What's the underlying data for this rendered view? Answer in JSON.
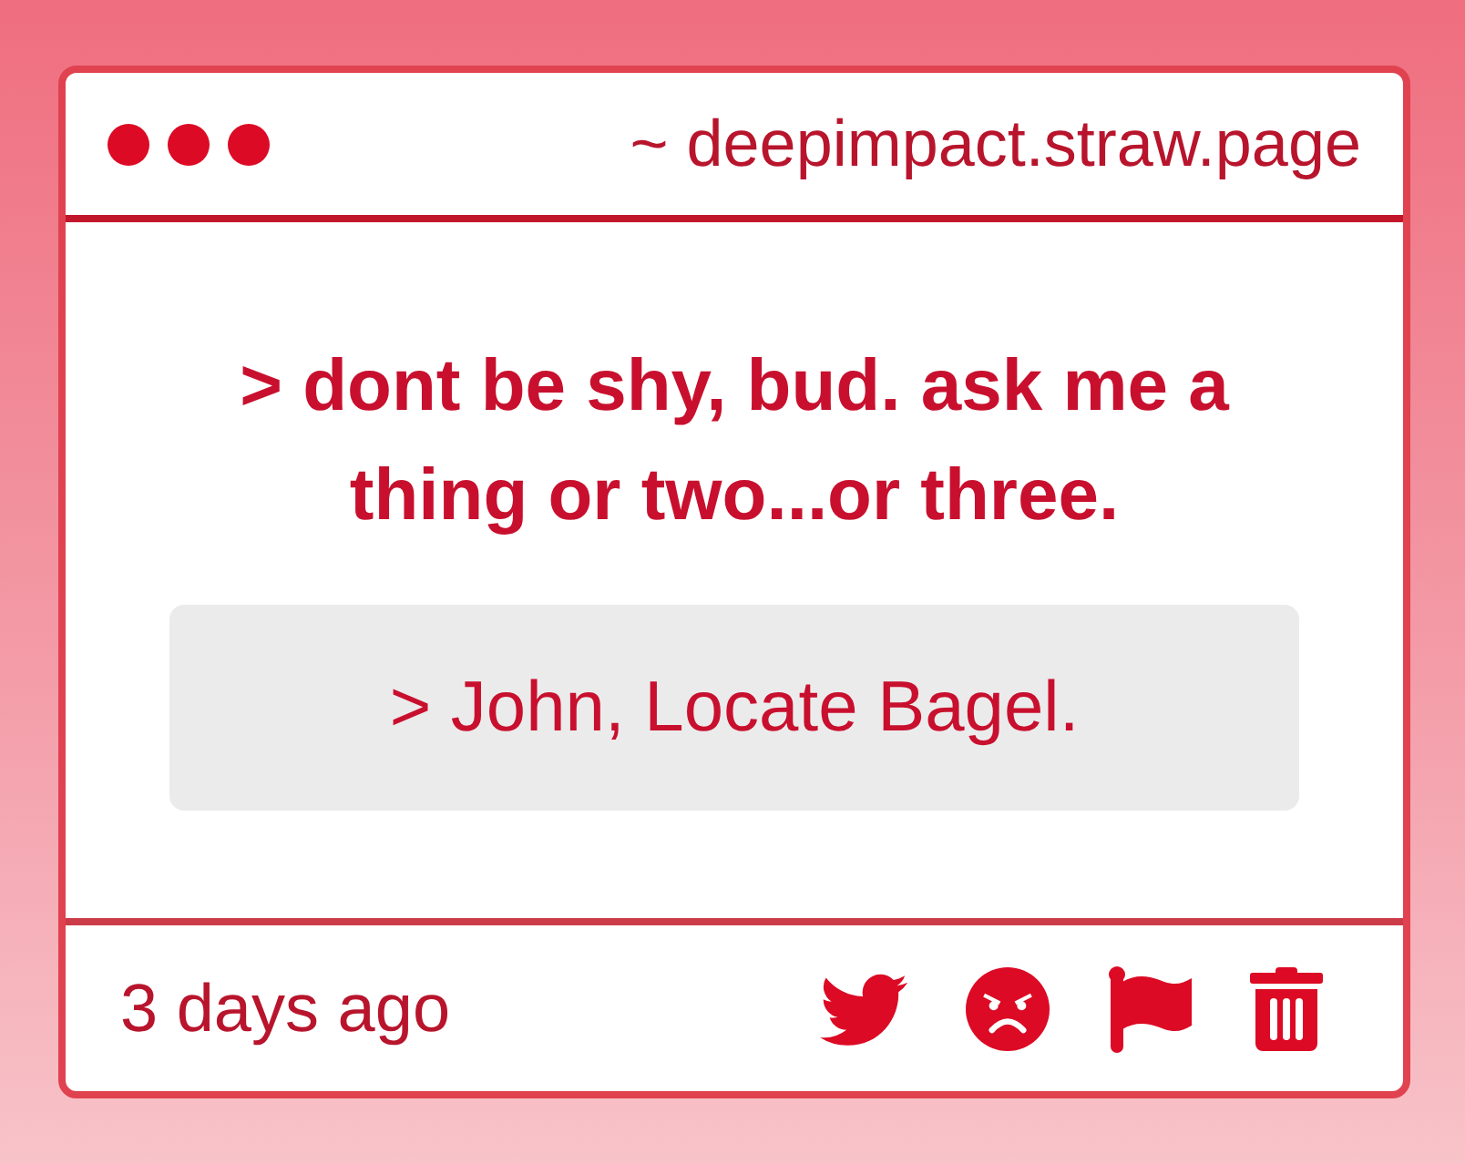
{
  "header": {
    "url": "~ deepimpact.straw.page"
  },
  "question": "> dont be shy, bud. ask me a thing or two...or three.",
  "answer": "> John, Locate Bagel.",
  "footer": {
    "timestamp": "3 days ago",
    "actions": [
      {
        "kind": "twitter"
      },
      {
        "kind": "angry"
      },
      {
        "kind": "flag"
      },
      {
        "kind": "delete"
      }
    ]
  }
}
